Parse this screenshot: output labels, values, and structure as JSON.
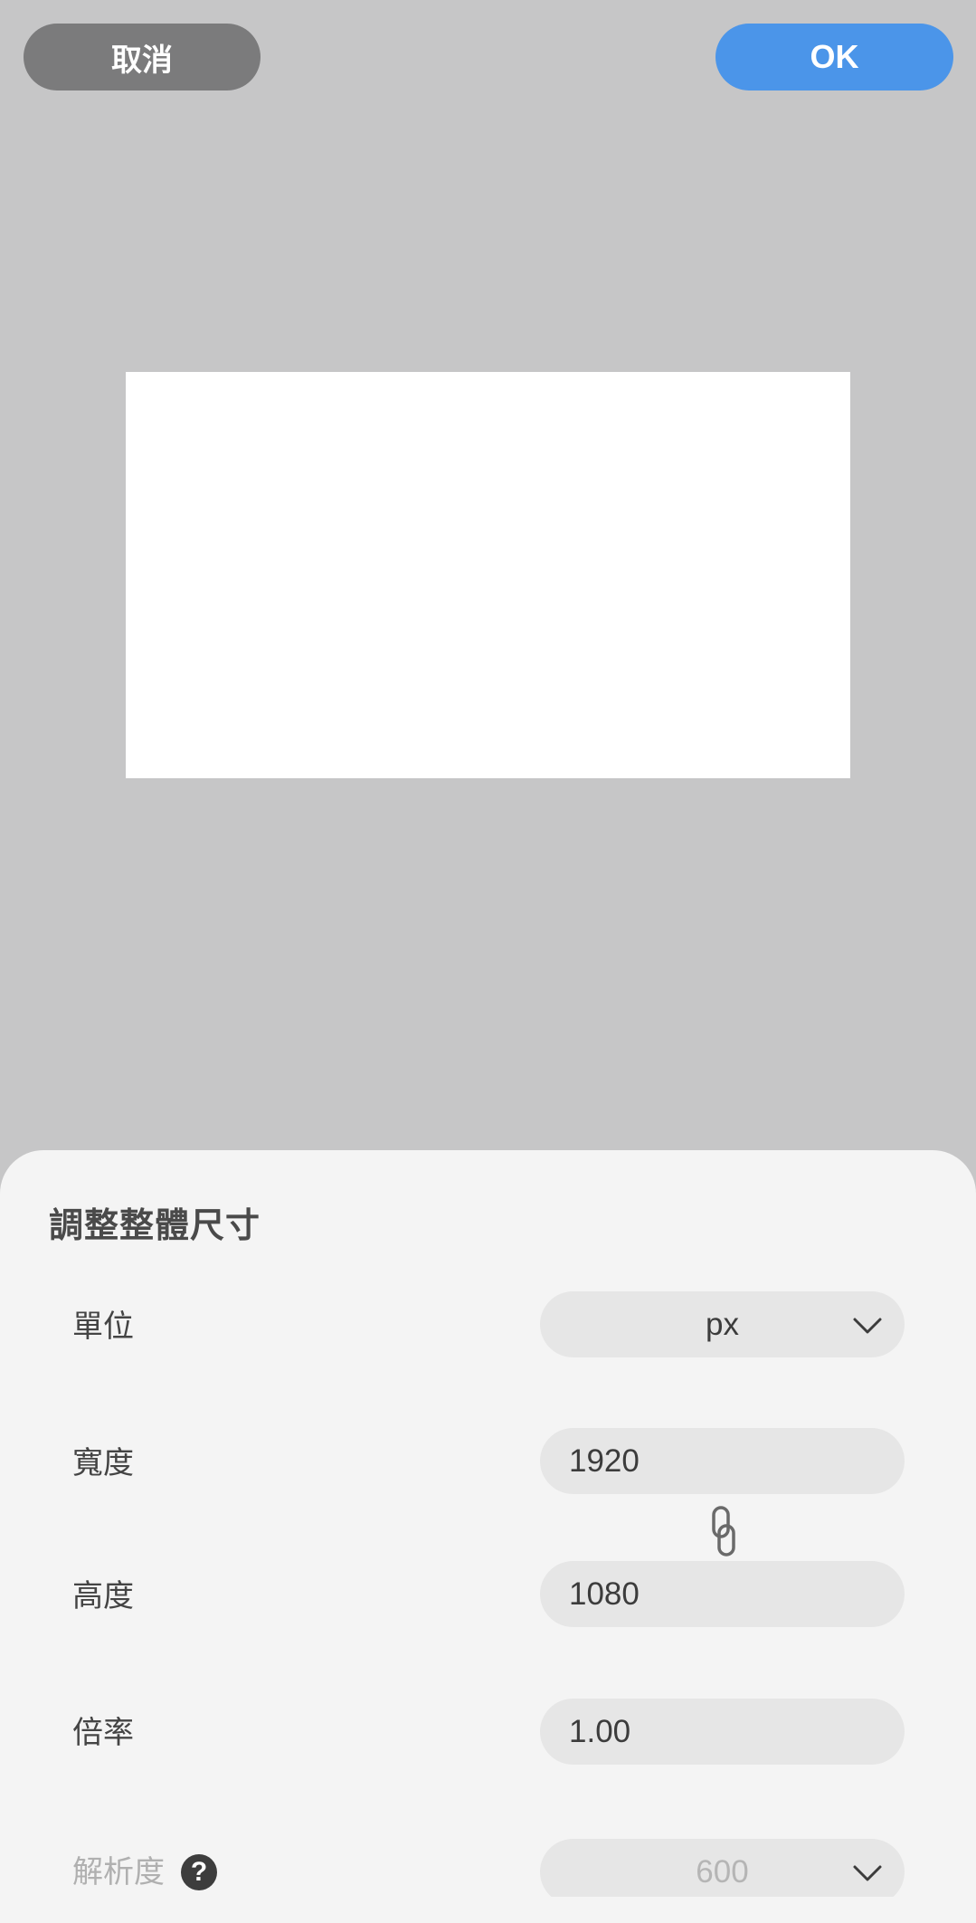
{
  "header": {
    "cancel_label": "取消",
    "ok_label": "OK"
  },
  "colors": {
    "background": "#c6c6c7",
    "cancel_button": "#7b7b7c",
    "ok_button": "#4b95e9",
    "sheet": "#f4f4f4",
    "field": "#e6e6e6"
  },
  "sheet": {
    "title": "調整整體尺寸",
    "unit": {
      "label": "單位",
      "value": "px",
      "icon": "chevron-down-icon"
    },
    "width": {
      "label": "寬度",
      "value": "1920"
    },
    "link_icon": "link-icon",
    "height": {
      "label": "高度",
      "value": "1080"
    },
    "scale": {
      "label": "倍率",
      "value": "1.00"
    },
    "resolution": {
      "label": "解析度",
      "value": "600",
      "help_glyph": "?",
      "icon": "chevron-down-icon"
    }
  }
}
